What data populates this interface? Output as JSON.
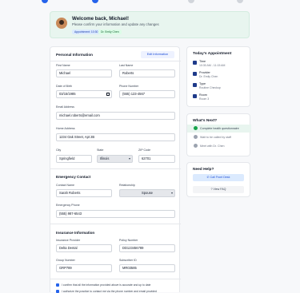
{
  "welcome": {
    "title": "Welcome back, Michael!",
    "subtitle": "Please confirm your information and update any changes",
    "appointment_badge": "Appointment: 10:30 AM",
    "doctor_badge": "Dr. Emily Chen"
  },
  "personal": {
    "title": "Personal Information",
    "edit_label": "Edit Information",
    "first_name_label": "First Name",
    "first_name": "Michael",
    "last_name_label": "Last Name",
    "last_name": "Roberts",
    "dob_label": "Date of Birth",
    "dob": "03/15/1985",
    "phone_label": "Phone Number",
    "phone": "(555) 123-4567",
    "email_label": "Email Address",
    "email": "michael.roberts@email.com",
    "address_label": "Home Address",
    "address": "1234 Oak Street, Apt 2B",
    "city_label": "City",
    "city": "Springfield",
    "state_label": "State",
    "state": "Illinois",
    "zip_label": "ZIP Code",
    "zip": "62701"
  },
  "emergency": {
    "title": "Emergency Contact",
    "contact_name_label": "Contact Name",
    "contact_name": "Sarah Roberts",
    "relationship_label": "Relationship",
    "relationship": "Spouse",
    "phone_label": "Emergency Phone",
    "phone": "(555) 987-6543"
  },
  "insurance": {
    "title": "Insurance Information",
    "provider_label": "Insurance Provider",
    "provider": "Delta Dental",
    "policy_label": "Policy Number",
    "policy": "DD123456789",
    "group_label": "Group Number",
    "group": "GRP789",
    "subscriber_label": "Subscriber ID",
    "subscriber": "MR03585"
  },
  "consent": {
    "line1": "I confirm that all the information provided above is accurate and up to date",
    "line2": "I authorize the practice to contact me via the phone number and email provided"
  },
  "appointment": {
    "title": "Today's Appointment",
    "time_label": "Time",
    "time": "10:30 AM - 11:15 AM",
    "provider_label": "Provider",
    "provider": "Dr. Emily Chen",
    "type_label": "Type",
    "type": "Routine Checkup",
    "room_label": "Room",
    "room": "Room 3"
  },
  "next": {
    "title": "What's Next?",
    "steps": [
      "Complete health questionnaire",
      "Wait to be called by staff",
      "Meet with Dr. Chen"
    ]
  },
  "help": {
    "title": "Need Help?",
    "call_label": "Call Front Desk",
    "faq_label": "View FAQ"
  },
  "colors": {
    "accent": "#2563eb",
    "success": "#16a34a",
    "welcome_bg": "#e8f5ef"
  }
}
